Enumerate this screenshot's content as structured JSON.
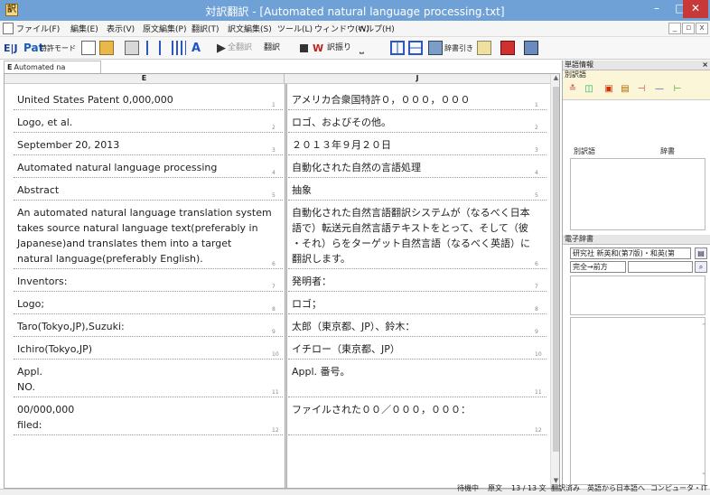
{
  "window": {
    "app_icon": "app-icon",
    "title": "対訳翻訳 - [Automated natural language processing.txt]"
  },
  "menu": [
    "ファイル(F)",
    "編集(E)",
    "表示(V)",
    "原文編集(P)",
    "翻訳(T)",
    "訳文編集(S)",
    "ツール(L)",
    "ウィンドウ(W)",
    "ヘルプ(H)"
  ],
  "toolbar": {
    "ej": "E|J",
    "pat": "Pat",
    "patent_mode": "特許モード",
    "translate_all": "全翻訳",
    "translate": "翻訳",
    "translate_word": "訳振り",
    "dict_lookup": "辞書引き"
  },
  "doc_tab": {
    "marker": "E",
    "label": "Automated na"
  },
  "editor": {
    "col_e": "E",
    "col_j": "J",
    "segments": [
      {
        "n": "1",
        "e": [
          "United States Patent 0,000,000"
        ],
        "j": [
          "アメリカ合衆国特許０，０００，０００"
        ]
      },
      {
        "n": "2",
        "e": [
          "Logo, et al."
        ],
        "j": [
          "ロゴ、およびその他。"
        ]
      },
      {
        "n": "3",
        "e": [
          "September 20, 2013"
        ],
        "j": [
          "２０１３年９月２０日"
        ]
      },
      {
        "n": "4",
        "e": [
          "Automated natural language processing"
        ],
        "j": [
          "自動化された自然の言語処理"
        ]
      },
      {
        "n": "5",
        "e": [
          "Abstract"
        ],
        "j": [
          "抽象"
        ]
      },
      {
        "n": "6",
        "e": [
          "An automated natural language translation system",
          "takes source natural language text(preferably in",
          "Japanese)and translates them into a target",
          "natural language(preferably English)."
        ],
        "j": [
          "自動化された自然言語翻訳システムが（なるべく日本",
          "語で）転送元自然言語テキストをとって、そして（彼",
          "・それ）らをターゲット自然言語（なるべく英語）に",
          "翻訳します。"
        ]
      },
      {
        "n": "7",
        "e": [
          "Inventors:"
        ],
        "j": [
          "発明者："
        ]
      },
      {
        "n": "8",
        "e": [
          "Logo;"
        ],
        "j": [
          "ロゴ；"
        ]
      },
      {
        "n": "9",
        "e": [
          "Taro(Tokyo,JP),Suzuki:"
        ],
        "j": [
          "太郎（東京都、JP）、鈴木："
        ]
      },
      {
        "n": "10",
        "e": [
          "Ichiro(Tokyo,JP)"
        ],
        "j": [
          "イチロー（東京都、JP）"
        ]
      },
      {
        "n": "11",
        "e": [
          "Appl.",
          "NO."
        ],
        "j": [
          "Appl. 番号。"
        ]
      },
      {
        "n": "12",
        "e": [
          "00/000,000",
          "filed:"
        ],
        "j": [
          "ファイルされた００／０００，０００："
        ]
      }
    ]
  },
  "right_pane": {
    "word_info_title": "単語情報",
    "alt_translation": "別訳語",
    "col_alt": "別訳語",
    "col_dict": "辞書",
    "edict_title": "電子辞書",
    "dict_select": "研究社 新英和(第7版)・和英(第",
    "match_mode": "完全→前方",
    "search_value": ""
  },
  "status": {
    "state": "待機中",
    "mode": "原文",
    "count": "13 / 13 文",
    "translated": "翻訳済み",
    "direction": "英語から日本語へ",
    "field": "コンピュータ・IT"
  }
}
